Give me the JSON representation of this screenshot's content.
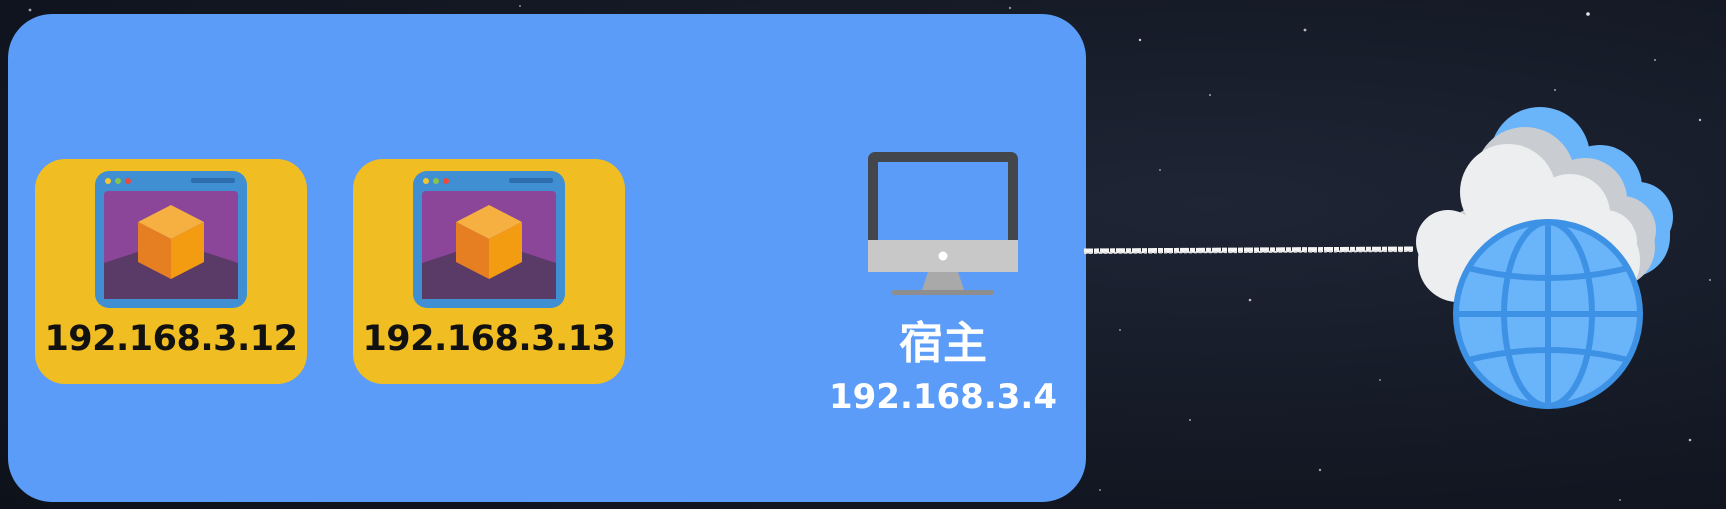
{
  "colors": {
    "background": "#141925",
    "host_panel": "#5b9cf8",
    "vm_card": "#f0bd22",
    "vm_ip_text": "#111111",
    "host_text": "#ffffff",
    "globe": "#6ab4fa",
    "cloud": "#e9ecef"
  },
  "virtual_machines": [
    {
      "ip": "192.168.3.12",
      "icon": "virtual-machine-window-icon"
    },
    {
      "ip": "192.168.3.13",
      "icon": "virtual-machine-window-icon"
    }
  ],
  "host": {
    "title": "宿主",
    "ip": "192.168.3.4",
    "icon": "desktop-computer-icon"
  },
  "internet": {
    "icon": "cloud-globe-icon"
  },
  "connection": {
    "icon": "network-line"
  }
}
